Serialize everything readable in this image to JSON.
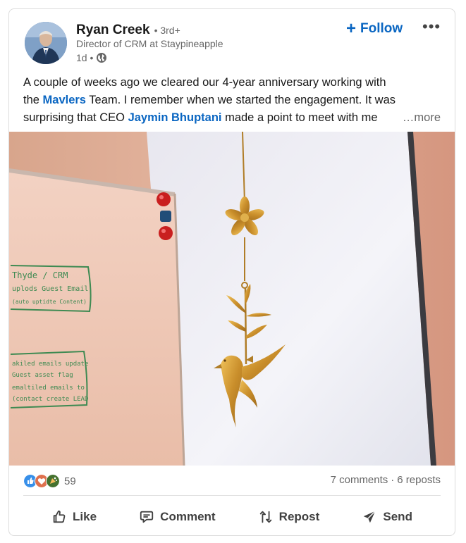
{
  "author": {
    "name": "Ryan Creek",
    "degree": "• 3rd+",
    "headline": "Director of CRM at Staypineapple",
    "time": "1d •"
  },
  "follow_label": "Follow",
  "post": {
    "line1": "A couple of weeks ago we cleared our 4-year anniversary working with",
    "line2_pre": "the ",
    "mention1": "Mavlers",
    "line2_post": " Team. I remember when we started the engagement. It was",
    "line3_pre": "surprising that CEO ",
    "mention2": "Jaymin Bhuptani",
    "line3_post": " made a point to meet with me",
    "see_more": "…more"
  },
  "whiteboard_text": [
    "Thyde / CRM",
    "uplods Guest Email",
    "(auto uptidte Content)",
    "akiled emails update",
    "Guest asset flag",
    "emaltiled emails to",
    "(contact create LEAD"
  ],
  "social": {
    "reaction_count": "59",
    "comments": "7 comments",
    "separator": "·",
    "reposts": "6 reposts"
  },
  "actions": {
    "like": "Like",
    "comment": "Comment",
    "repost": "Repost",
    "send": "Send"
  },
  "colors": {
    "accent": "#0a66c2",
    "text": "#191919",
    "muted": "#666666"
  }
}
